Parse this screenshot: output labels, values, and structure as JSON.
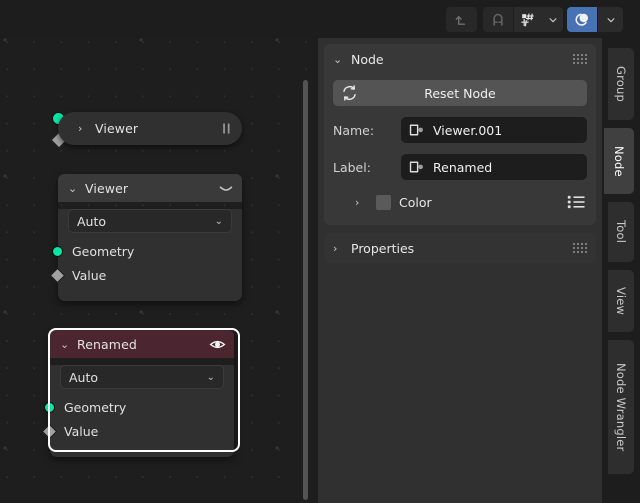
{
  "topbar": {
    "buttons": [
      {
        "name": "parent-up-button",
        "icon": "arrow-up-left-icon",
        "state": "dimmed"
      },
      {
        "name": "snap-magnet-toggle",
        "icon": "magnet-icon",
        "state": "off"
      },
      {
        "name": "snap-target-button",
        "icon": "snap-grid-icon",
        "state": "normal"
      },
      {
        "name": "snap-dropdown",
        "icon": "chevron-down-icon",
        "state": "normal"
      },
      {
        "name": "proportional-editing-toggle",
        "icon": "proportional-editing-icon",
        "state": "on"
      },
      {
        "name": "proportional-falloff-dropdown",
        "icon": "chevron-down-icon",
        "state": "normal"
      }
    ]
  },
  "canvas": {
    "nodes": [
      {
        "name": "viewer-node-collapsed",
        "title": "Viewer",
        "collapsed": true,
        "collapse_arrow": "›",
        "right_icon": "pause-bars-icon",
        "sockets": [
          {
            "name": "geometry-socket",
            "shape": "circle",
            "color": "#00e6a5"
          },
          {
            "name": "value-socket",
            "shape": "diamond",
            "color": "#a1a1a1"
          }
        ]
      },
      {
        "name": "viewer-node-expanded",
        "title": "Viewer",
        "collapsed": false,
        "collapse_arrow": "⌄",
        "header_color": "#3a3a3a",
        "right_icon": "eye-closed-icon",
        "selected": false,
        "dropdown": {
          "value": "Auto",
          "arrow": "⌄"
        },
        "inputs": [
          {
            "label": "Geometry",
            "shape": "circle",
            "color": "#00e6a5"
          },
          {
            "label": "Value",
            "shape": "diamond",
            "color": "#a1a1a1"
          }
        ]
      },
      {
        "name": "renamed-node",
        "title": "Renamed",
        "collapsed": false,
        "collapse_arrow": "⌄",
        "header_color": "#4b2630",
        "right_icon": "eye-open-icon",
        "selected": true,
        "dropdown": {
          "value": "Auto",
          "arrow": "⌄"
        },
        "inputs": [
          {
            "label": "Geometry",
            "shape": "circle",
            "color": "#00e6a5"
          },
          {
            "label": "Value",
            "shape": "diamond",
            "color": "#a1a1a1"
          }
        ]
      }
    ]
  },
  "sidebar": {
    "node_panel": {
      "title": "Node",
      "arrow": "⌄",
      "reset_button": "Reset Node",
      "name_label": "Name:",
      "name_value": "Viewer.001",
      "label_label": "Label:",
      "label_value": "Renamed",
      "color_row": {
        "label": "Color",
        "arrow": "›",
        "swatch_color": "#5a5a5a"
      }
    },
    "properties_panel": {
      "title": "Properties",
      "arrow": "›"
    }
  },
  "tabs": [
    {
      "label": "Group",
      "active": false
    },
    {
      "label": "Node",
      "active": true
    },
    {
      "label": "Tool",
      "active": false
    },
    {
      "label": "View",
      "active": false
    },
    {
      "label": "Node Wrangler",
      "active": false
    }
  ]
}
